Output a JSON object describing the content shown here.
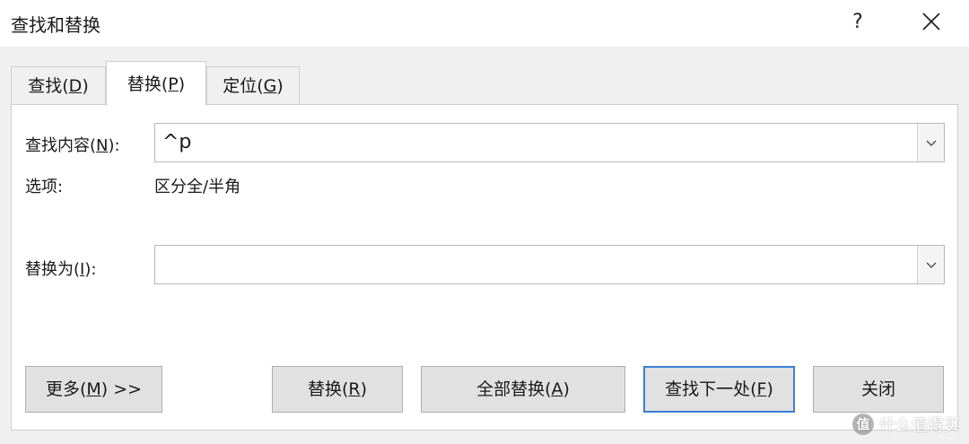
{
  "window": {
    "title": "查找和替换",
    "help_label": "?"
  },
  "tabs": [
    {
      "pre": "查找(",
      "key": "D",
      "post": ")",
      "active": false
    },
    {
      "pre": "替换(",
      "key": "P",
      "post": ")",
      "active": true
    },
    {
      "pre": "定位(",
      "key": "G",
      "post": ")",
      "active": false
    }
  ],
  "find": {
    "label_pre": "查找内容(",
    "label_key": "N",
    "label_post": "):",
    "value": "^p"
  },
  "options": {
    "label": "选项:",
    "value": "区分全/半角"
  },
  "replace": {
    "label_pre": "替换为(",
    "label_key": "I",
    "label_post": "):",
    "value": ""
  },
  "buttons": {
    "more": {
      "pre": "更多(",
      "key": "M",
      "post": ") >>"
    },
    "replace": {
      "pre": "替换(",
      "key": "R",
      "post": ")"
    },
    "replace_all": {
      "pre": "全部替换(",
      "key": "A",
      "post": ")"
    },
    "find_next": {
      "pre": "查找下一处(",
      "key": "F",
      "post": ")"
    },
    "close": {
      "label": "关闭"
    }
  },
  "watermark": {
    "logo": "值",
    "text": "什么值得买"
  },
  "colors": {
    "default_button_border": "#3c7fd6",
    "panel_bg": "#ffffff",
    "dialog_bg": "#f0f0f0"
  }
}
